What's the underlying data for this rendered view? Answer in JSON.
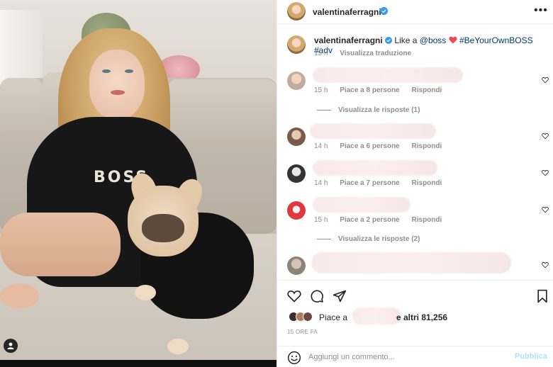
{
  "post": {
    "author": "valentinaferragni",
    "more_label": "•••",
    "caption": {
      "username": "valentinaferragni",
      "text": "Like a",
      "mention": "@boss",
      "hashtag1": "#BeYourOwnBOSS",
      "hashtag2": "#adv",
      "time": "15 h",
      "translate": "Visualizza traduzione"
    },
    "photo_print": "BOSS"
  },
  "comments": [
    {
      "time": "15 h",
      "likes": "Piace a 8 persone",
      "reply": "Rispondi",
      "view_replies": "Visualizza le risposte (1)"
    },
    {
      "time": "14 h",
      "likes": "Piace a 6 persone",
      "reply": "Rispondi"
    },
    {
      "time": "14 h",
      "likes": "Piace a 7 persone",
      "reply": "Rispondi"
    },
    {
      "time": "15 h",
      "likes": "Piace a 2 persone",
      "reply": "Rispondi",
      "view_replies": "Visualizza le risposte (2)"
    }
  ],
  "likes": {
    "prefix": "Piace a",
    "suffix": "e altri 81,256"
  },
  "timestamp": "15 ORE FA",
  "composer": {
    "placeholder": "Aggiungi un commento...",
    "publish": "Pubblica"
  },
  "colors": {
    "link": "#00376b",
    "verified": "#3897f0",
    "heart": "#ed4956",
    "muted": "#8e8e8e",
    "publish": "#b2dffc"
  },
  "icons": [
    "verified-badge-icon",
    "more-icon",
    "heart-outline-icon",
    "comment-icon",
    "share-icon",
    "bookmark-icon",
    "emoji-icon",
    "user-tag-icon"
  ]
}
